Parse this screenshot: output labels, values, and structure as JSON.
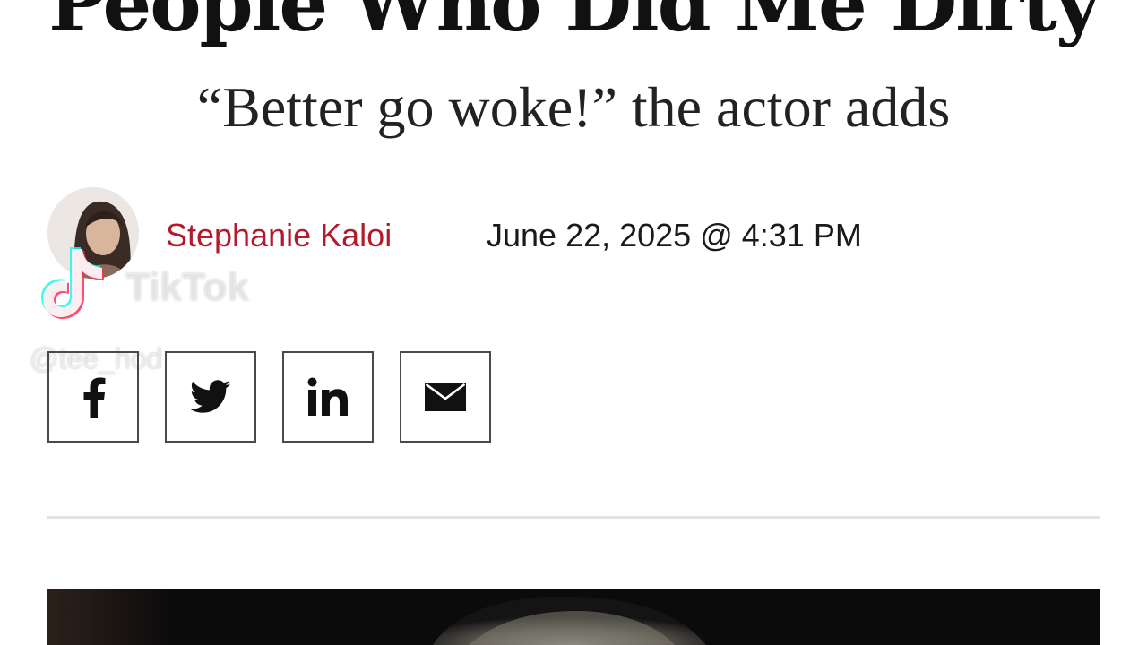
{
  "article": {
    "headline": "People Who Did Me Dirty",
    "subheadline": "“Better go woke!” the actor adds",
    "author": "Stephanie Kaloi",
    "date": "June 22, 2025 @ 4:31 PM"
  },
  "share": {
    "buttons": [
      {
        "icon": "facebook-icon"
      },
      {
        "icon": "twitter-icon"
      },
      {
        "icon": "linkedin-icon"
      },
      {
        "icon": "email-icon"
      }
    ]
  },
  "watermark": {
    "brand": "TikTok",
    "handle": "@tee_hod"
  },
  "colors": {
    "author_link": "#b31b2b",
    "text": "#111111",
    "divider": "#e2e2e2",
    "tiktok_cyan": "#25f4ee",
    "tiktok_red": "#fe2c55"
  }
}
